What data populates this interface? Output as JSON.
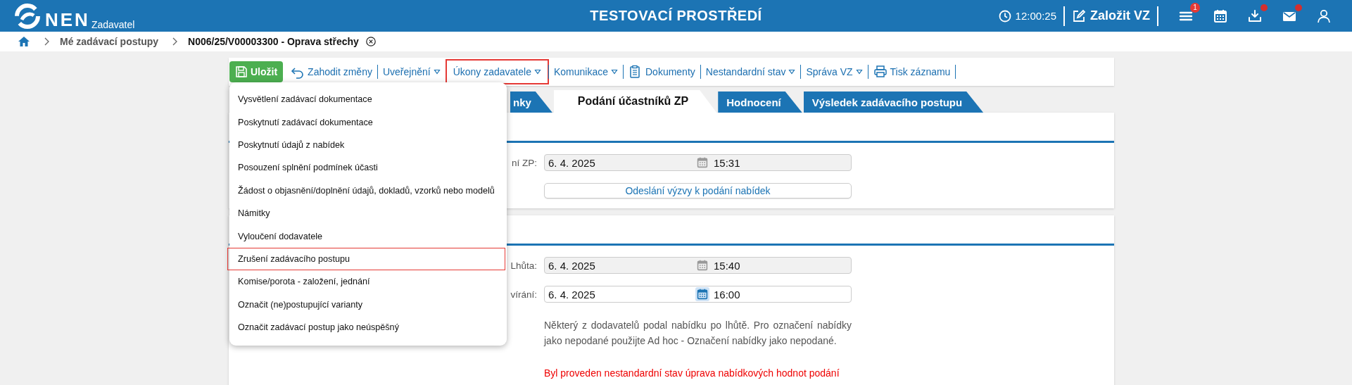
{
  "header": {
    "logo": "NEN",
    "subtitle": "Zadavatel",
    "title": "TESTOVACÍ PROSTŘEDÍ",
    "time": "12:00:25",
    "create_button": "Založit VZ",
    "actions": [
      {
        "kind": "menu",
        "badge": "1",
        "dot": false
      },
      {
        "kind": "calendar",
        "dot": false
      },
      {
        "kind": "download",
        "dot": true
      },
      {
        "kind": "mail",
        "dot": true
      },
      {
        "kind": "user",
        "dot": false
      }
    ]
  },
  "breadcrumb": [
    {
      "label": "Mé zadávací postupy",
      "current": false
    },
    {
      "label": "N006/25/V00003300 - Oprava střechy",
      "current": true
    }
  ],
  "toolbar": [
    {
      "kind": "save",
      "label": "Uložit",
      "highlighted": false
    },
    {
      "kind": "undo",
      "label": "Zahodit změny",
      "highlighted": false
    },
    {
      "kind": "dropdown",
      "label": "Uveřejnění",
      "highlighted": false
    },
    {
      "kind": "dropdown",
      "label": "Úkony zadavatele",
      "highlighted": true
    },
    {
      "kind": "dropdown",
      "label": "Komunikace",
      "highlighted": false
    },
    {
      "kind": "documents",
      "label": "Dokumenty",
      "highlighted": false
    },
    {
      "kind": "dropdown",
      "label": "Nestandardní stav",
      "highlighted": false
    },
    {
      "kind": "dropdown",
      "label": "Správa VZ",
      "highlighted": false
    },
    {
      "kind": "print",
      "label": "Tisk záznamu",
      "highlighted": false
    }
  ],
  "tabs": [
    {
      "label": "nky",
      "selected": false
    },
    {
      "label": "Podání účastníků ZP",
      "selected": true
    },
    {
      "label": "Hodnocení",
      "selected": false
    },
    {
      "label": "Výsledek zadávacího postupu",
      "selected": false
    }
  ],
  "menu": {
    "items": [
      {
        "label": "Vysvětlení zadávací dokumentace",
        "highlighted": false
      },
      {
        "label": "Poskytnutí zadávací dokumentace",
        "highlighted": false
      },
      {
        "label": "Poskytnutí údajů z nabídek",
        "highlighted": false
      },
      {
        "label": "Posouzení splnění podmínek účasti",
        "highlighted": false
      },
      {
        "label": "Žádost o objasnění/doplnění údajů, dokladů, vzorků nebo modelů",
        "highlighted": false
      },
      {
        "label": "Námitky",
        "highlighted": false
      },
      {
        "label": "Vyloučení dodavatele",
        "highlighted": false
      },
      {
        "label": "Zrušení zadávacího postupu",
        "highlighted": true
      },
      {
        "label": "Komise/porota - založení, jednání",
        "highlighted": false
      },
      {
        "label": "Označit (ne)postupující varianty",
        "highlighted": false
      },
      {
        "label": "Označit zadávací postup jako neúspěšný",
        "highlighted": false
      }
    ]
  },
  "sections": [
    {
      "rows": [
        {
          "kind": "datetime",
          "label": "ní ZP:",
          "date": "6. 4. 2025",
          "time": "15:31",
          "disabled": true,
          "focused": false
        },
        {
          "kind": "button",
          "label": "Odeslání výzvy k podání nabídek"
        }
      ]
    },
    {
      "rows": [
        {
          "kind": "datetime",
          "label": "Lhůta:",
          "date": "6. 4. 2025",
          "time": "15:40",
          "disabled": true,
          "focused": false
        },
        {
          "kind": "datetime",
          "label": "vírání:",
          "date": "6. 4. 2025",
          "time": "16:00",
          "disabled": false,
          "focused": true
        },
        {
          "kind": "note",
          "text": "Některý z dodavatelů podal nabídku po lhůtě. Pro označení nabídky jako nepodané použijte Ad hoc - Označení nabídky jako nepodané."
        },
        {
          "kind": "alert",
          "text": "Byl proveden nestandardní stav úprava nabídkových hodnot podání"
        }
      ]
    }
  ]
}
